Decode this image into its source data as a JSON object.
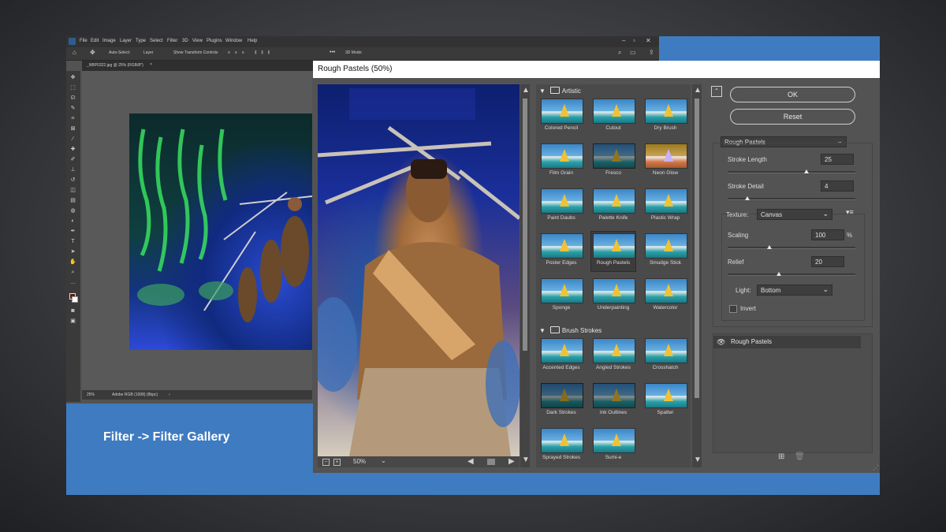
{
  "colors": {
    "accent_blue": "#3f7bc0",
    "ps_bg": "#535353",
    "dialog_bg": "#535353"
  },
  "caption": "Filter -> Filter Gallery",
  "photoshop": {
    "menus": [
      "File",
      "Edit",
      "Image",
      "Layer",
      "Type",
      "Select",
      "Filter",
      "3D",
      "View",
      "Plugins",
      "Window",
      "Help"
    ],
    "options": {
      "auto_select": "Auto-Select:",
      "layer": "Layer",
      "transform": "Show Transform Controls",
      "mode": "3D Mode:"
    },
    "document_tab": "_NBP0322.jpg @ 25% (RGB/8*)",
    "status": {
      "zoom": "25%",
      "profile": "Adobe RGB (1998) (8bpc)"
    }
  },
  "dialog": {
    "title": "Rough Pastels (50%)",
    "zoom": "50%",
    "categories": [
      {
        "name": "Artistic",
        "filters": [
          "Colored Pencil",
          "Cutout",
          "Dry Brush",
          "Film Grain",
          "Fresco",
          "Neon Glow",
          "Paint Daubs",
          "Palette Knife",
          "Plastic Wrap",
          "Poster Edges",
          "Rough Pastels",
          "Smudge Stick",
          "Sponge",
          "Underpainting",
          "Watercolor"
        ]
      },
      {
        "name": "Brush Strokes",
        "filters": [
          "Accented Edges",
          "Angled Strokes",
          "Crosshatch",
          "Dark Strokes",
          "Ink Outlines",
          "Spatter",
          "Sprayed Strokes",
          "Sumi-e"
        ]
      }
    ],
    "selected_filter": "Rough Pastels",
    "ok_label": "OK",
    "reset_label": "Reset",
    "filter_select": "Rough Pastels",
    "stroke_length": {
      "label": "Stroke Length",
      "value": "25"
    },
    "stroke_detail": {
      "label": "Stroke Detail",
      "value": "4"
    },
    "texture": {
      "label": "Texture:",
      "value": "Canvas"
    },
    "scaling": {
      "label": "Scaling",
      "value": "100",
      "unit": "%"
    },
    "relief": {
      "label": "Relief",
      "value": "20"
    },
    "light": {
      "label": "Light:",
      "value": "Bottom"
    },
    "invert_label": "Invert",
    "layer_name": "Rough Pastels"
  }
}
